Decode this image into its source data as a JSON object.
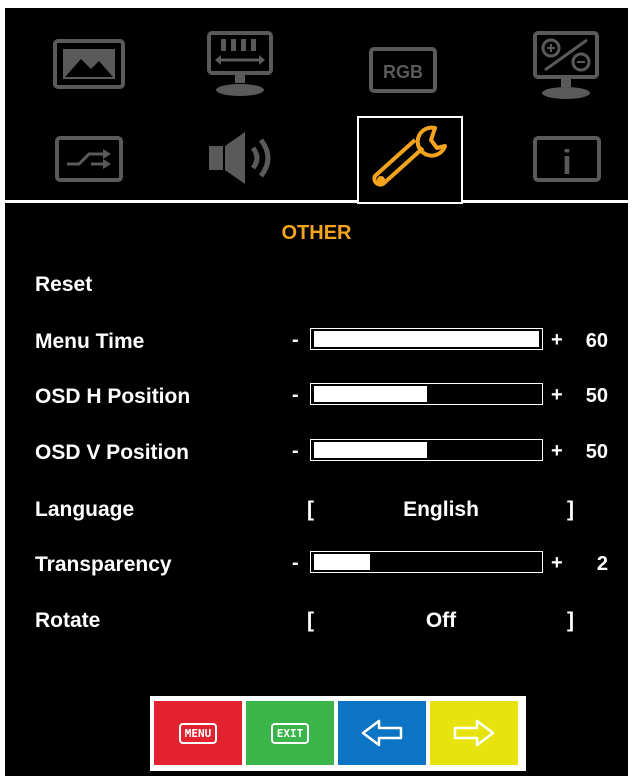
{
  "tabs": [
    {
      "icon": "picture-icon",
      "selected": false
    },
    {
      "icon": "display-icon",
      "selected": false
    },
    {
      "icon": "rgb-icon",
      "label": "RGB",
      "selected": false
    },
    {
      "icon": "color-adjust-icon",
      "selected": false
    },
    {
      "icon": "input-source-icon",
      "selected": false
    },
    {
      "icon": "speaker-icon",
      "selected": false
    },
    {
      "icon": "wrench-icon",
      "selected": true
    },
    {
      "icon": "info-icon",
      "label": "i",
      "selected": false
    }
  ],
  "section_title": "OTHER",
  "rows": {
    "reset": {
      "label": "Reset"
    },
    "menu_time": {
      "label": "Menu Time",
      "minus": "-",
      "plus": "+",
      "value": "60",
      "fill_fraction": 1.0
    },
    "osd_h": {
      "label": "OSD H Position",
      "minus": "-",
      "plus": "+",
      "value": "50",
      "fill_fraction": 0.5
    },
    "osd_v": {
      "label": "OSD V Position",
      "minus": "-",
      "plus": "+",
      "value": "50",
      "fill_fraction": 0.5
    },
    "language": {
      "label": "Language",
      "open": "[",
      "value": "English",
      "close": "]"
    },
    "transparency": {
      "label": "Transparency",
      "minus": "-",
      "plus": "+",
      "value": "2",
      "fill_fraction": 0.25
    },
    "rotate": {
      "label": "Rotate",
      "open": "[",
      "value": "Off",
      "close": "]"
    }
  },
  "buttons": {
    "menu": {
      "label": "MENU",
      "color": "#e3222f"
    },
    "exit": {
      "label": "EXIT",
      "color": "#3ab54a"
    },
    "left": {
      "icon": "arrow-left-icon",
      "color": "#0b74c4"
    },
    "right": {
      "icon": "arrow-right-icon",
      "color": "#e7e30e"
    }
  },
  "colors": {
    "accent": "#f4a41c",
    "icon_gray": "#5a5a5a",
    "background": "#000000"
  }
}
